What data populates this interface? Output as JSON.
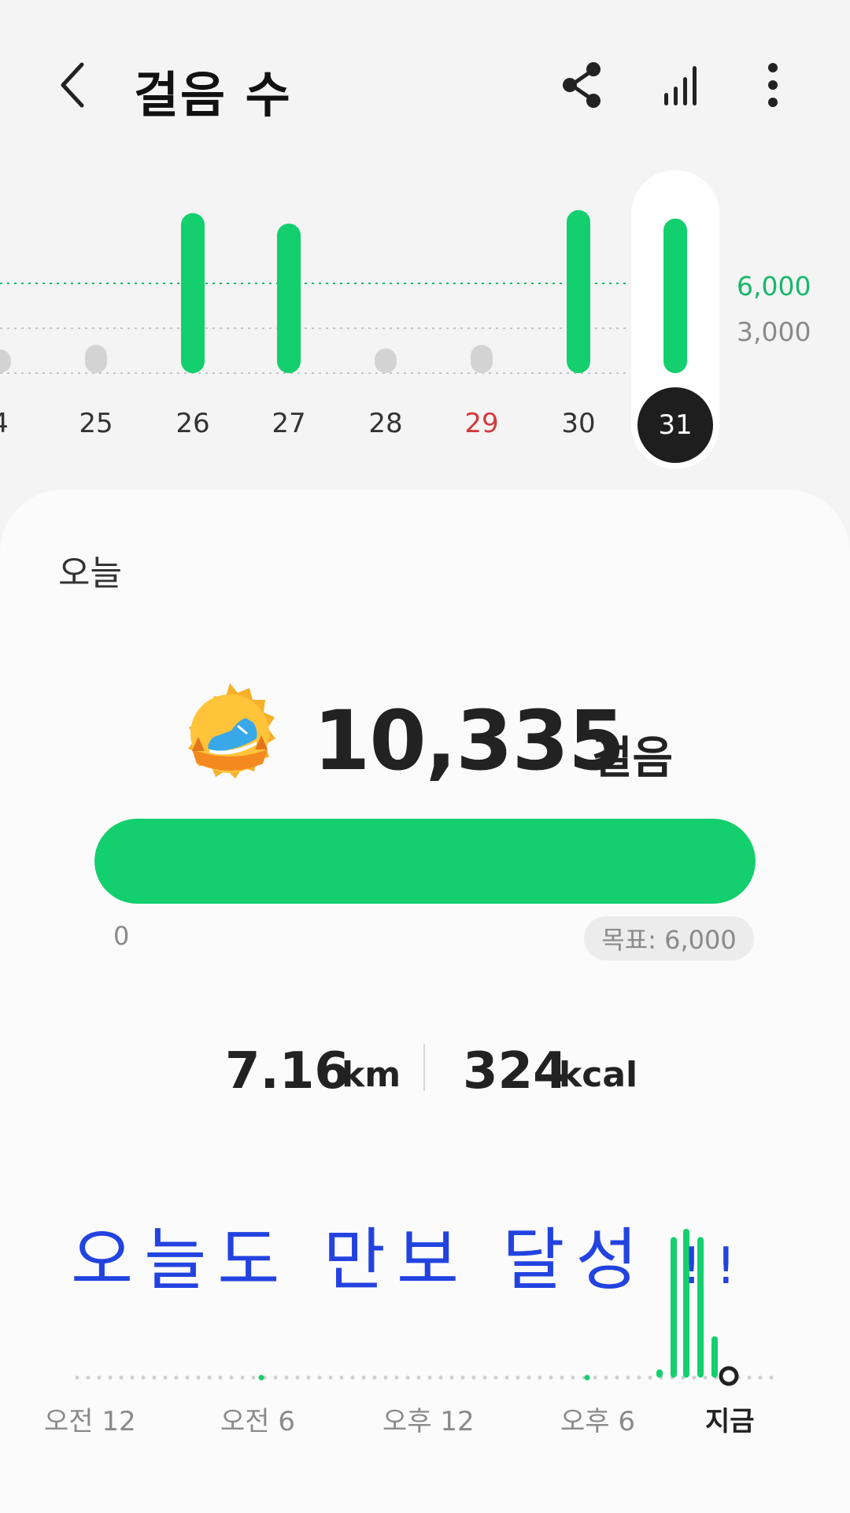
{
  "header": {
    "title": "걸음 수",
    "icons": [
      "back-chevron-icon",
      "share-icon",
      "stats-bars-icon",
      "more-vertical-icon"
    ]
  },
  "weekly_chart": {
    "y_labels": {
      "goal": "6,000",
      "mid": "3,000"
    },
    "days": [
      {
        "label": "4",
        "value": 300
      },
      {
        "label": "25",
        "value": 1200
      },
      {
        "label": "26",
        "value": 10700
      },
      {
        "label": "27",
        "value": 10000
      },
      {
        "label": "28",
        "value": 500
      },
      {
        "label": "29",
        "value": 1200,
        "holiday": true
      },
      {
        "label": "30",
        "value": 10900
      },
      {
        "label": "31",
        "value": 10335,
        "selected": true
      }
    ]
  },
  "today": {
    "period_label": "오늘",
    "badge_icon": "running-shoe-badge-icon",
    "steps": "10,335",
    "steps_unit": "걸음",
    "progress_fraction": 1.0,
    "progress_min": "0",
    "goal_label": "목표: 6,000",
    "distance": "7.16",
    "distance_unit": "km",
    "calories": "324",
    "calories_unit": "kcal"
  },
  "overlay_text": {
    "main": "오늘도 만보 달성",
    "exclaim": "!!"
  },
  "hourly_chart": {
    "time_labels": [
      "오전 12",
      "오전 6",
      "오후 12",
      "오후 6",
      "지금"
    ],
    "recent_bars": [
      0.05,
      0.85,
      0.9,
      0.85,
      0.25
    ]
  },
  "colors": {
    "accent_green": "#13cf6e",
    "holiday_red": "#d23b3b",
    "overlay_blue": "#2343e0",
    "selected_dark": "#1e1e1e"
  }
}
